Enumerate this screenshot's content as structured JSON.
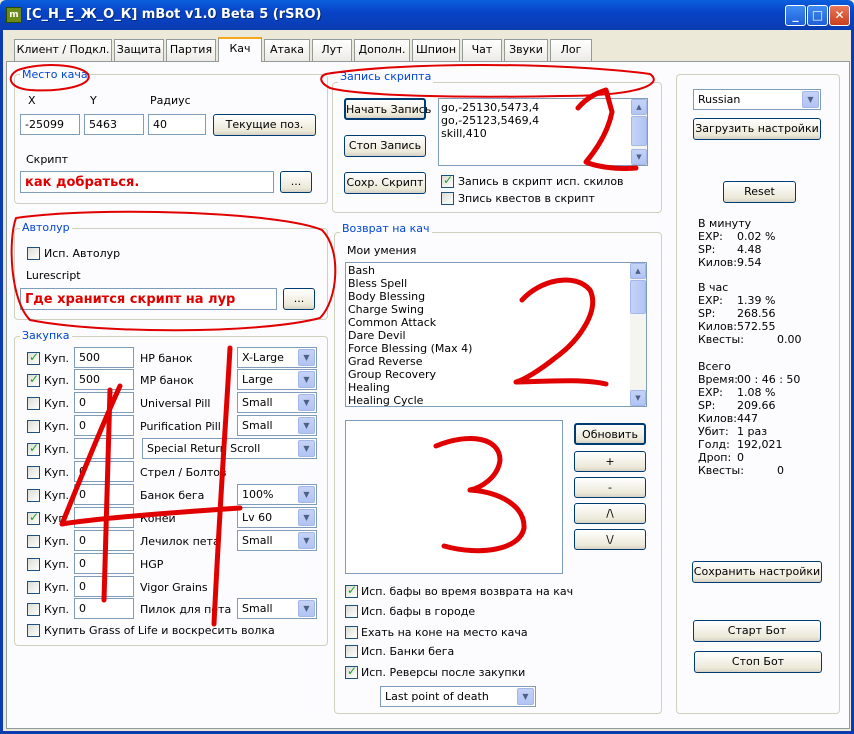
{
  "window": {
    "title": "[С_Н_Е_Ж_О_К] mBot v1.0 Beta 5 (rSRO)",
    "icon_text": "m",
    "minimize": "_",
    "maximize": "□",
    "close": "✕"
  },
  "tabs": [
    "Клиент / Подкл.",
    "Защита",
    "Партия",
    "Кач",
    "Атака",
    "Лут",
    "Дополн.",
    "Шпион",
    "Чат",
    "Звуки",
    "Лог"
  ],
  "training_place": {
    "legend": "Место кача",
    "x_label": "X",
    "y_label": "Y",
    "radius_label": "Радиус",
    "x": "-25099",
    "y": "5463",
    "radius": "40",
    "current_pos_button": "Текущие поз.",
    "script_label": "Скрипт",
    "script_value": "как добраться.",
    "browse_button": "..."
  },
  "script_recording": {
    "legend": "Запись скрипта",
    "start_button": "Начать Запись",
    "stop_button": "Стоп Запись",
    "save_button": "Сохр. Скрипт",
    "lines": [
      "go,-25130,5473,4",
      "go,-25123,5469,4",
      "skill,410"
    ],
    "record_skills_label": "Запись в скрипт исп. скилов",
    "record_skills_checked": true,
    "record_quests_label": "Зпись квестов в скрипт",
    "record_quests_checked": false
  },
  "autoloot": {
    "legend": "Автолур",
    "use_label": "Исп. Автолур",
    "use_checked": false,
    "lurescript_label": "Lurescript",
    "lurescript_value": "Где хранится скрипт на лур",
    "browse_button": "..."
  },
  "purchase": {
    "legend": "Закупка",
    "rows": [
      {
        "buy_label": "Куп.",
        "checked": true,
        "qty": "500",
        "item": "HP банок",
        "option": "X-Large"
      },
      {
        "buy_label": "Куп.",
        "checked": true,
        "qty": "500",
        "item": "MP банок",
        "option": "Large"
      },
      {
        "buy_label": "Куп.",
        "checked": false,
        "qty": "0",
        "item": "Universal Pill",
        "option": "Small"
      },
      {
        "buy_label": "Куп.",
        "checked": false,
        "qty": "0",
        "item": "Purification Pill",
        "option": "Small"
      },
      {
        "buy_label": "Куп.",
        "checked": true,
        "qty": "",
        "item": "",
        "option": "Special Return Scroll"
      },
      {
        "buy_label": "Куп.",
        "checked": false,
        "qty": "0",
        "item": "Стрел / Болтов",
        "option": ""
      },
      {
        "buy_label": "Куп.",
        "checked": false,
        "qty": "0",
        "item": "Банок бега",
        "option": "100%"
      },
      {
        "buy_label": "Куп.",
        "checked": true,
        "qty": "",
        "item": "Коней",
        "option": "Lv 60"
      },
      {
        "buy_label": "Куп.",
        "checked": false,
        "qty": "0",
        "item": "Лечилок пета",
        "option": "Small"
      },
      {
        "buy_label": "Куп.",
        "checked": false,
        "qty": "0",
        "item": "HGP",
        "option": ""
      },
      {
        "buy_label": "Куп.",
        "checked": false,
        "qty": "0",
        "item": "Vigor Grains",
        "option": ""
      },
      {
        "buy_label": "Куп.",
        "checked": false,
        "qty": "0",
        "item": "Пилок для пета",
        "option": "Small"
      }
    ],
    "grass_label": "Купить Grass of Life и воскресить волка",
    "grass_checked": false
  },
  "return": {
    "legend": "Возврат на кач",
    "skills_label": "Мои умения",
    "skills": [
      "Bash",
      "Bless Spell",
      "Body Blessing",
      "Charge Swing",
      "Common Attack",
      "Dare Devil",
      "Force Blessing (Max 4)",
      "Grad Reverse",
      "Group Recovery",
      "Healing",
      "Healing Cycle"
    ],
    "refresh_button": "Обновить",
    "add_button": "+",
    "remove_button": "-",
    "up_button": "/\\",
    "down_button": "\\/",
    "options": [
      {
        "label": "Исп. бафы во время возврата на кач",
        "checked": true
      },
      {
        "label": "Исп. бафы в городе",
        "checked": false
      },
      {
        "label": "Ехать на коне на место кача",
        "checked": false
      },
      {
        "label": "Исп. Банки бега",
        "checked": false
      },
      {
        "label": "Исп. Реверсы после закупки",
        "checked": true
      }
    ],
    "reverse_option": "Last point of death"
  },
  "sidebar": {
    "language": "Russian",
    "load_settings_button": "Загрузить настройки",
    "reset_button": "Reset",
    "per_minute_title": "В минуту",
    "per_minute": [
      {
        "label": "EXP:",
        "value": "0.02 %"
      },
      {
        "label": "SP:",
        "value": "4.48"
      },
      {
        "label": "Килов:",
        "value": "9.54"
      }
    ],
    "per_hour_title": "В час",
    "per_hour": [
      {
        "label": "EXP:",
        "value": "1.39 %"
      },
      {
        "label": "SP:",
        "value": "268.56"
      },
      {
        "label": "Килов:",
        "value": "572.55"
      },
      {
        "label": "Квесты:",
        "value": "0.00"
      }
    ],
    "total_title": "Всего",
    "total": [
      {
        "label": "Время:",
        "value": "00 : 46 : 50"
      },
      {
        "label": "EXP:",
        "value": "1.08 %"
      },
      {
        "label": "SP:",
        "value": "209.66"
      },
      {
        "label": "Килов:",
        "value": "447"
      },
      {
        "label": "Убит:",
        "value": "1 раз"
      },
      {
        "label": "Голд:",
        "value": "192,021"
      },
      {
        "label": "Дроп:",
        "value": "0"
      },
      {
        "label": "Квесты:",
        "value": "0"
      }
    ],
    "save_settings_button": "Сохранить настройки",
    "start_bot_button": "Старт Бот",
    "stop_bot_button": "Стоп Бот"
  },
  "annotations": {
    "color": "#e00000",
    "numbers": [
      "1",
      "2",
      "3",
      "4"
    ]
  }
}
